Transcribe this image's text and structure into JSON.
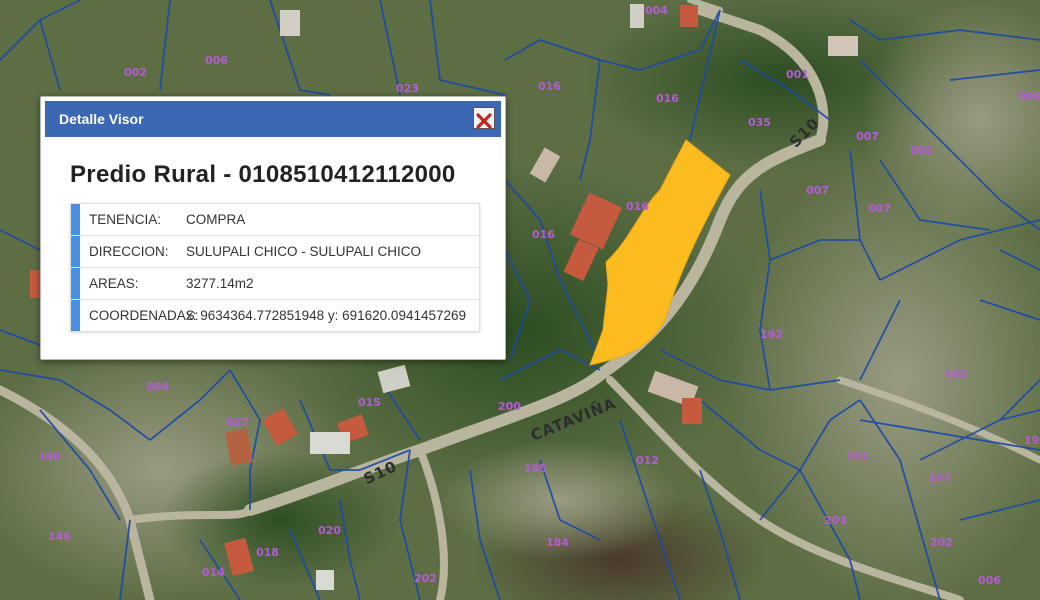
{
  "map": {
    "road_labels": [
      "S10",
      "S10",
      "CATAVIÑA"
    ],
    "plot_labels": [
      "004",
      "001",
      "006",
      "023",
      "016",
      "016",
      "035",
      "002",
      "007",
      "006",
      "007",
      "007",
      "002",
      "016",
      "016",
      "192",
      "193",
      "004",
      "027",
      "015",
      "200",
      "146",
      "012",
      "185",
      "201",
      "197",
      "203",
      "202",
      "020",
      "018",
      "014",
      "202",
      "184",
      "146",
      "190",
      "006"
    ],
    "colors": {
      "highlight": "#fcbb1e",
      "parcel_lines": "#1b4aa8",
      "plot_text": "#b65bd6"
    }
  },
  "popup": {
    "header_title": "Detalle Visor",
    "close_icon": "close-icon",
    "title": "Predio Rural - 0108510412112000",
    "rows": [
      {
        "label": "TENENCIA:",
        "value": "COMPRA"
      },
      {
        "label": "DIRECCION:",
        "value": "SULUPALI CHICO - SULUPALI CHICO"
      },
      {
        "label": "AREAS:",
        "value": "3277.14m2"
      },
      {
        "label": "COORDENADAS:",
        "value": "x: 9634364.772851948 y: 691620.0941457269"
      }
    ]
  }
}
